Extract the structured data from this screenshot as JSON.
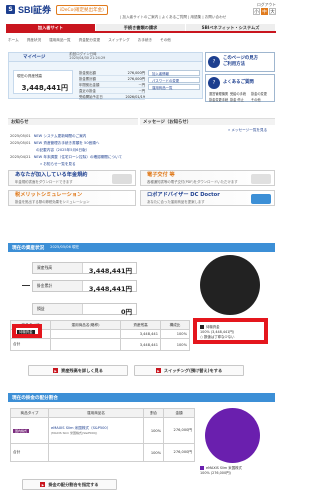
{
  "brand": {
    "mark": "S",
    "name": "SBI証券",
    "badge": "iDeCo(確定拠出年金)"
  },
  "header": {
    "links": "| 加入者サイトのご案内 | よくあるご質問 | 用語集 | お問い合わせ",
    "logout": "ログアウト",
    "font_size_label": "文字サイズ",
    "font_sizes": [
      "小",
      "中",
      "大"
    ]
  },
  "tabs": [
    "加入者サイト",
    "手続き書類の請求",
    "SBIベネフィット・システムズ"
  ],
  "subnav": [
    "ホーム",
    "資産状況",
    "運用商品一覧",
    "資金配分変更",
    "スイッチング",
    "お手続き",
    "その他"
  ],
  "mypage": {
    "title": "マイページ",
    "last_login_label": "前回ログイン日時",
    "last_login_value": "2025/04/30 21:24:29"
  },
  "summary": {
    "asset_label": "現在の資産残高",
    "asset_value": "3,448,441円",
    "rows": [
      {
        "k": "掛金拠出額",
        "v": "276,000円"
      },
      {
        "k": "掛金累計額",
        "v": "276,000円"
      },
      {
        "k": "年間拠出金額",
        "v": "－円"
      },
      {
        "k": "直近の掛金",
        "v": "－円"
      },
      {
        "k": "受給開始予定日",
        "v": "2026/01/19"
      }
    ],
    "side_buttons": [
      "加入者情報",
      "パスワードの変更",
      "運用商品一覧"
    ]
  },
  "right_panel": {
    "guide_title": "このページの見方",
    "guide_sub": "ご利用方法",
    "faq_title": "よくあるご質問",
    "faq_items": [
      "運営管理機関",
      "受給の手続",
      "掛金の変更",
      "掛金変更手続",
      "掛金 停止",
      "その他"
    ]
  },
  "notices_head": "お知らせ",
  "messages_head": "メッセージ（お知らせ）",
  "messages_more": "» メッセージ一覧を見る",
  "notices": [
    {
      "date": "2025/05/01",
      "text": "NEW システム更新時間のご案内"
    },
    {
      "date": "2025/05/01",
      "text": "NEW 資産管理お手続き書類を 50音順へ"
    },
    {
      "date": "",
      "text": "の記載内容（2025年5月6日版）"
    },
    {
      "date": "2025/04/21",
      "text": "NEW 年末調整（住宅ローン控除）の確認期間について"
    }
  ],
  "notices_more": "» お知らせ一覧を見る",
  "banners": [
    {
      "title": "あなたが加入している年金規約",
      "sub": "年金規約書面をダウンロードできます"
    },
    {
      "title": "電子交付 等",
      "sub": "各種通知書等の電子交付(PDF)をダウンロードいただけます"
    },
    {
      "title": "税メリットシミュレーション",
      "sub": "掛金を拠出する際の節税効果をシミュレーション"
    },
    {
      "title": "ロボアドバイザー DC Doctor",
      "sub": "あなたに合った運用商品を提案します"
    }
  ],
  "status": {
    "title": "現在の資産状況",
    "date": "2025/05/06 現在",
    "rows": [
      {
        "label": "資産残高",
        "value": "3,448,441円"
      },
      {
        "label": "掛金累計",
        "value": "3,448,441円"
      },
      {
        "label": "損益",
        "value": "0円"
      }
    ],
    "table_headers": [
      "商品タイプ",
      "運用商品名(略称)",
      "資産残高",
      "構成比"
    ],
    "table_rows": [
      {
        "type": "待機資金",
        "name": "",
        "amount": "3,448,441",
        "pct": "100%"
      }
    ],
    "total_label": "合計",
    "total_amount": "3,448,441",
    "total_pct": "100%",
    "legend": [
      {
        "name": "待機資金",
        "detail": "100% (3,448,441円)",
        "color": "#222222"
      },
      {
        "name": "○ 数値は丁寧な少ない",
        "detail": "",
        "color": "#ffffff"
      }
    ],
    "btn_detail": "資産残高を詳しく見る",
    "btn_switch": "スイッチング(預け替え)をする"
  },
  "allocation": {
    "title": "現在の掛金の配分割合",
    "table_headers": [
      "商品タイプ",
      "運用商品名",
      "割合",
      "金額"
    ],
    "rows": [
      {
        "type": "国内株式",
        "name": "eMAXIS Slim 米国株式（S&P500）",
        "note": "(MAXIS Slim 米国株式(S&P500))",
        "pct": "100%",
        "amount": "276,000円"
      }
    ],
    "total_label": "合計",
    "total_pct": "100%",
    "total_amount": "276,000円",
    "legend": [
      {
        "name": "eMAXIS Slim 米国株式",
        "detail": "100% (276,000円)",
        "color": "#6a1fae"
      }
    ],
    "btn_change": "掛金の配分割合を指定する"
  },
  "colors": {
    "brand": "#1d3f8f",
    "accent": "#c9151e",
    "section": "#3c8fd6",
    "highlight": "#e4161d",
    "pie1": "#222222",
    "pie2": "#6a1fae"
  }
}
